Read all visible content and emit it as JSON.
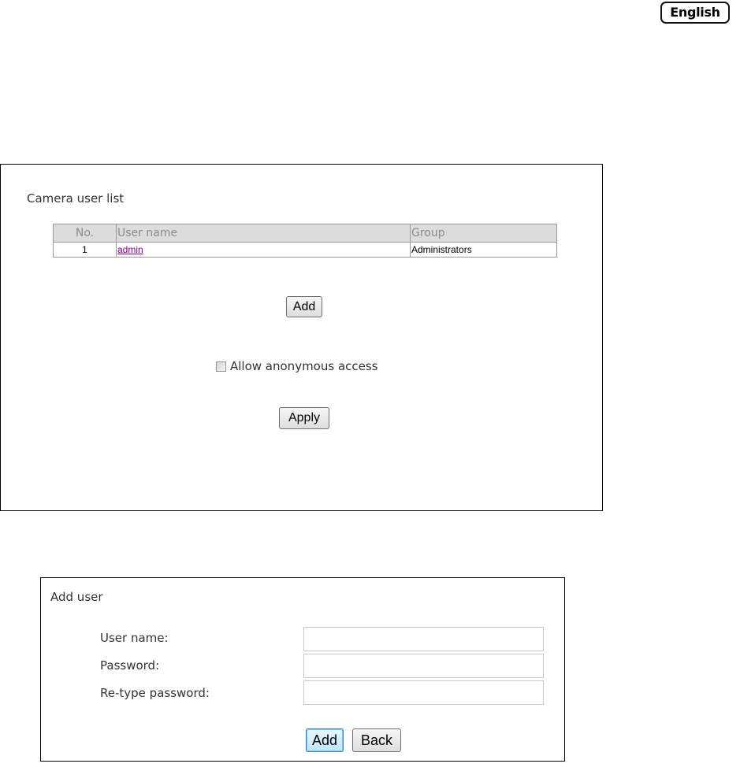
{
  "language": {
    "label": "English"
  },
  "user_list": {
    "title": "Camera user list",
    "columns": [
      "No.",
      "User name",
      "Group"
    ],
    "rows": [
      {
        "no": "1",
        "username": "admin",
        "group": "Administrators"
      }
    ],
    "add_button": "Add",
    "anonymous_label": "Allow anonymous access",
    "anonymous_checked": false,
    "apply_button": "Apply"
  },
  "add_user": {
    "title": "Add user",
    "username_label": "User name:",
    "password_label": "Password:",
    "retype_label": "Re-type password:",
    "username_value": "",
    "password_value": "",
    "retype_value": "",
    "add_button": "Add",
    "back_button": "Back"
  }
}
